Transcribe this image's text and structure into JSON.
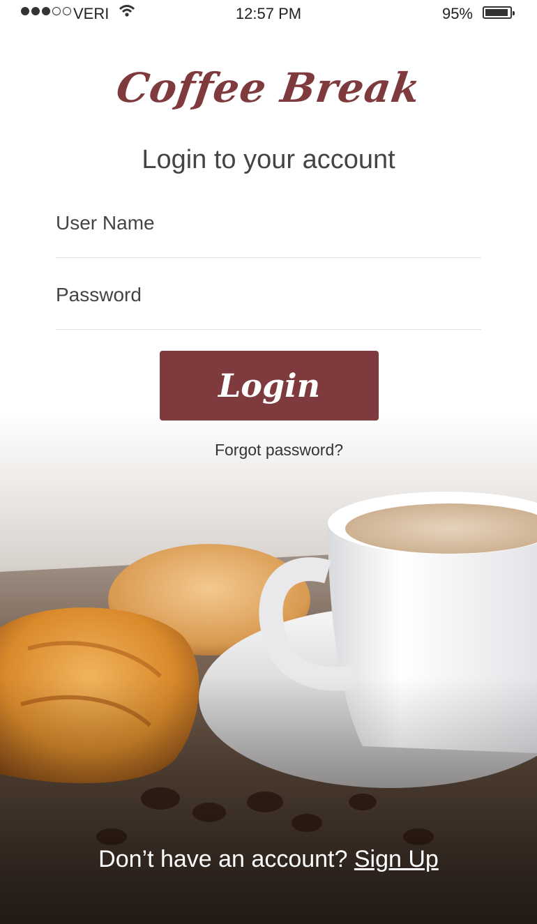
{
  "status_bar": {
    "carrier": "VERI",
    "time": "12:57 PM",
    "battery_percent": "95%",
    "battery_level": 0.95,
    "signal_bars": 3
  },
  "app": {
    "logo_text": "Coffee Break",
    "subtitle": "Login to your account",
    "brand_color": "#7f3a3e"
  },
  "form": {
    "username_placeholder": "User Name",
    "username_value": "",
    "password_placeholder": "Password",
    "password_value": "",
    "login_label": "Login",
    "forgot_label": "Forgot password?"
  },
  "footer": {
    "prompt": "Don’t have an account?",
    "signup_label": "Sign Up"
  }
}
